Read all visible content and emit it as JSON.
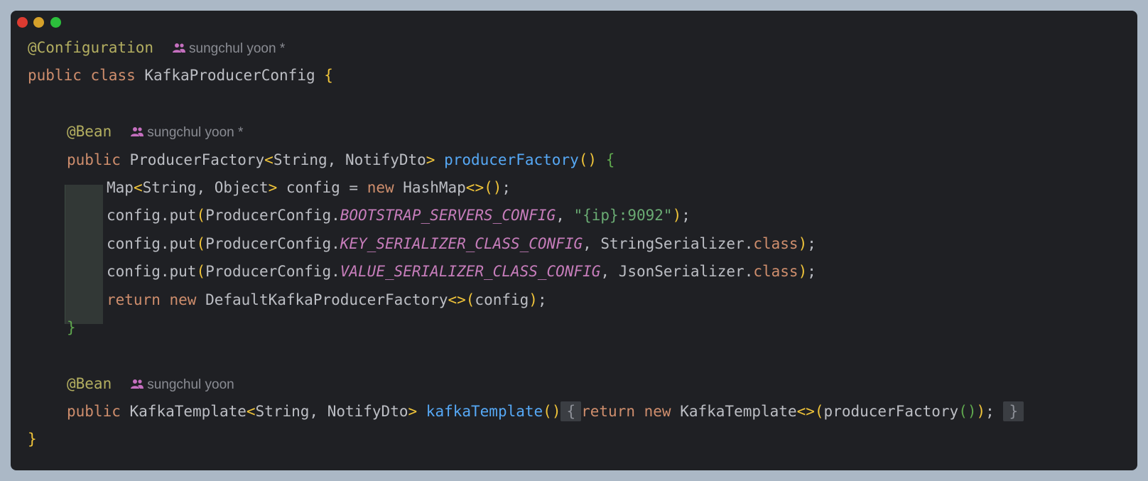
{
  "window": {
    "buttons": [
      "close",
      "minimize",
      "zoom"
    ],
    "colors": {
      "background": "#1f2024",
      "frame": "#abb8c6",
      "close": "#dd3b31",
      "minimize": "#d6a12a",
      "zoom": "#2cbf3c"
    }
  },
  "code": {
    "annotation_configuration": "@Configuration",
    "author_hint_1": "sungchul yoon *",
    "line2": {
      "kw1": "public",
      "kw2": "class",
      "name": "KafkaProducerConfig",
      "brace": "{"
    },
    "bean1": {
      "annotation": "@Bean",
      "author_hint": "sungchul yoon *"
    },
    "method1": {
      "kw": "public",
      "type": "ProducerFactory",
      "lt": "<",
      "generics": "String, NotifyDto",
      "gt": ">",
      "name": "producerFactory",
      "parens": "()",
      "brace": "{"
    },
    "body1": {
      "map_type": "Map",
      "lt": "<",
      "generics": "String, Object",
      "gt": ">",
      "decl": " config = ",
      "new_kw": "new",
      "hashmap": " HashMap",
      "diamond": "<>",
      "parens": "()",
      "semi": ";"
    },
    "put1": {
      "call": "config.put",
      "open": "(",
      "cls": "ProducerConfig.",
      "const": "BOOTSTRAP_SERVERS_CONFIG",
      "comma": ", ",
      "str": "\"{ip}:9092\"",
      "close": ")",
      "semi": ";"
    },
    "put2": {
      "call": "config.put",
      "open": "(",
      "cls": "ProducerConfig.",
      "const": "KEY_SERIALIZER_CLASS_CONFIG",
      "arg": ", StringSerializer.",
      "class_kw": "class",
      "close": ")",
      "semi": ";"
    },
    "put3": {
      "call": "config.put",
      "open": "(",
      "cls": "ProducerConfig.",
      "const": "VALUE_SERIALIZER_CLASS_CONFIG",
      "arg": ", JsonSerializer.",
      "class_kw": "class",
      "close": ")",
      "semi": ";"
    },
    "ret1": {
      "ret": "return",
      "new_kw": "new",
      "cls": " DefaultKafkaProducerFactory",
      "diamond": "<>",
      "open": "(",
      "arg": "config",
      "close": ")",
      "semi": ";"
    },
    "method1_close": "}",
    "bean2": {
      "annotation": "@Bean",
      "author_hint": "sungchul yoon"
    },
    "method2": {
      "kw": "public",
      "type": "KafkaTemplate",
      "lt": "<",
      "generics": "String, NotifyDto",
      "gt": ">",
      "name": "kafkaTemplate",
      "parens": "()",
      "fold_open": "{",
      "ret": "return",
      "new_kw": "new",
      "cls": " KafkaTemplate",
      "diamond": "<>",
      "open": "(",
      "inner": "producerFactory",
      "inner_parens": "()",
      "close": ")",
      "semi": ";",
      "fold_close": "}"
    },
    "class_close": "}"
  },
  "icons": {
    "author_hint_icon": "people-icon"
  }
}
